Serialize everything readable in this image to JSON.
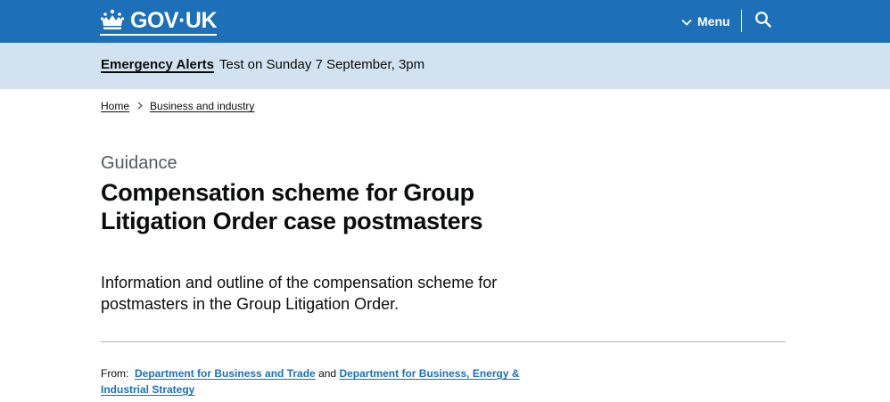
{
  "header": {
    "logo_text": "GOV·UK",
    "menu_label": "Menu",
    "search_icon": "search-icon",
    "background_color": "#1d70b8"
  },
  "alert": {
    "link_text": "Emergency Alerts",
    "message": "Test on Sunday 7 September, 3pm",
    "background_color": "#d2e2f1"
  },
  "breadcrumbs": [
    {
      "label": "Home"
    },
    {
      "label": "Business and industry"
    }
  ],
  "page": {
    "caption": "Guidance",
    "title": "Compensation scheme for Group Litigation Order case postmasters",
    "lead": "Information and outline of the compensation scheme for postmasters in the Group Litigation Order."
  },
  "from": {
    "label": "From:",
    "org1": "Department for Business and Trade",
    "conjunction": "and",
    "org2": "Department for Business, Energy & Industrial Strategy",
    "link_color": "#1d70b8"
  }
}
